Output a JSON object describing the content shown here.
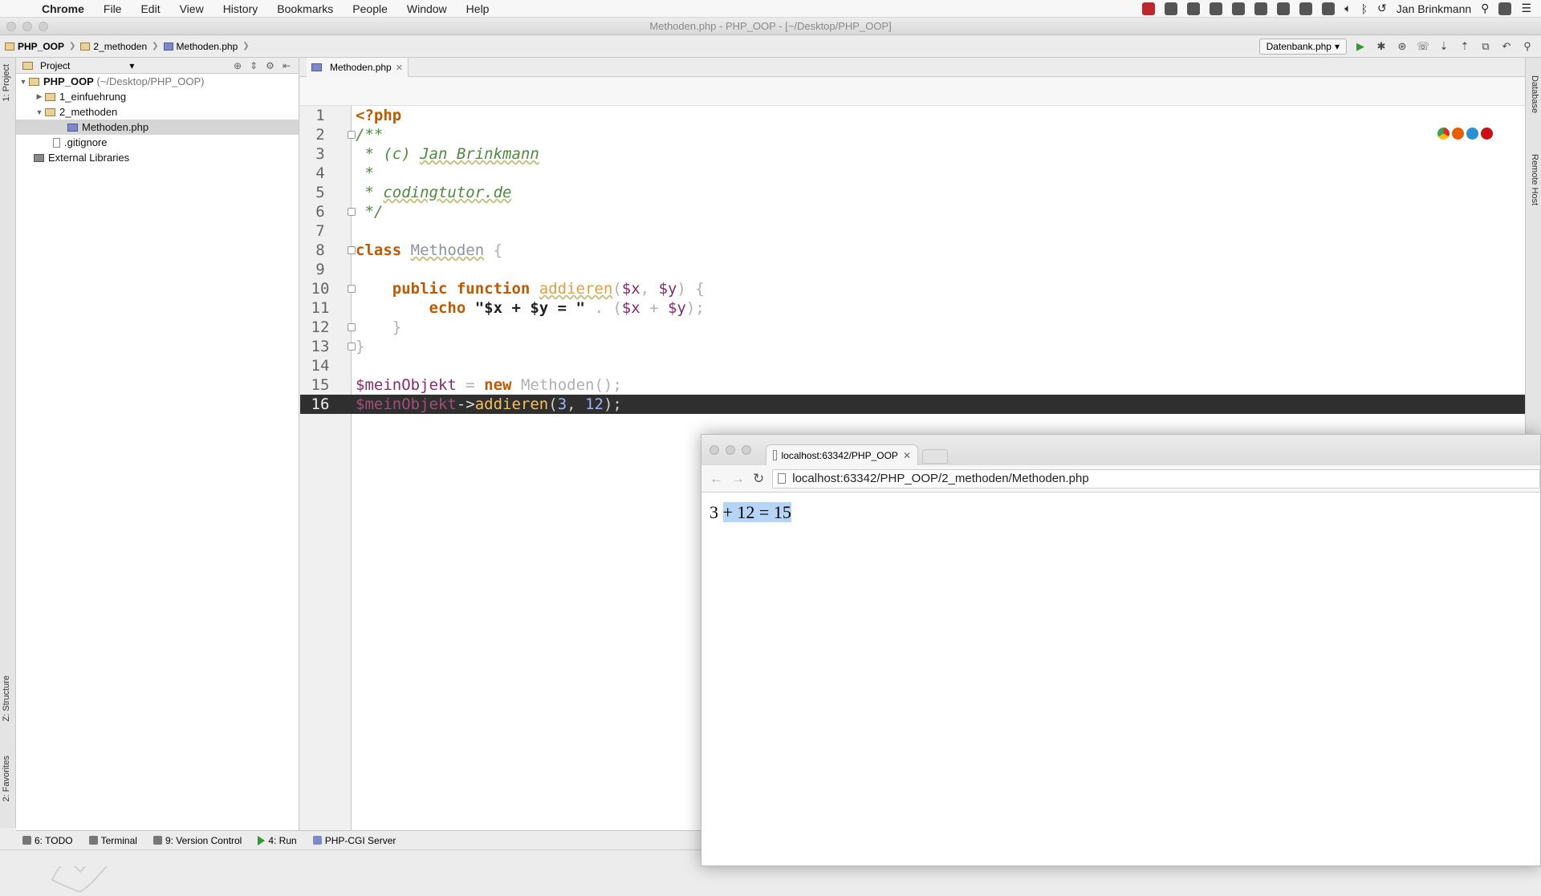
{
  "menubar": {
    "app": "Chrome",
    "items": [
      "File",
      "Edit",
      "View",
      "History",
      "Bookmarks",
      "People",
      "Window",
      "Help"
    ],
    "user": "Jan Brinkmann"
  },
  "window": {
    "title": "Methoden.php - PHP_OOP - [~/Desktop/PHP_OOP]"
  },
  "navbar": {
    "breadcrumbs": [
      "PHP_OOP",
      "2_methoden",
      "Methoden.php"
    ],
    "run_config": "Datenbank.php"
  },
  "left_tabs": {
    "project": "1: Project",
    "structure": "Z: Structure",
    "favorites": "2: Favorites"
  },
  "right_tabs": {
    "database": "Database",
    "remote_host": "Remote Host"
  },
  "project": {
    "header": "Project",
    "root_name": "PHP_OOP",
    "root_path": "(~/Desktop/PHP_OOP)",
    "folder1": "1_einfuehrung",
    "folder2": "2_methoden",
    "file_selected": "Methoden.php",
    "gitignore": ".gitignore",
    "libraries": "External Libraries"
  },
  "editor": {
    "tab": "Methoden.php",
    "lines": [
      "1",
      "2",
      "3",
      "4",
      "5",
      "6",
      "7",
      "8",
      "9",
      "10",
      "11",
      "12",
      "13",
      "14",
      "15",
      "16"
    ],
    "code": {
      "l1": "<?php",
      "l2": "/**",
      "l3a": " * (c) ",
      "l3b": "Jan Brinkmann",
      "l4": " *",
      "l5a": " * ",
      "l5b": "codingtutor.de",
      "l6": " */",
      "l8a": "class ",
      "l8b": "Methoden",
      "l8c": " {",
      "l10a": "    public function ",
      "l10b": "addieren",
      "l10c": "(",
      "l10d": "$x",
      "l10e": ", ",
      "l10f": "$y",
      "l10g": ") {",
      "l11a": "        echo ",
      "l11b": "\"$x + $y = \"",
      "l11c": " . (",
      "l11d": "$x",
      "l11e": " + ",
      "l11f": "$y",
      "l11g": ");",
      "l12": "    }",
      "l13": "}",
      "l15a": "$meinObjekt",
      "l15b": " = ",
      "l15c": "new ",
      "l15d": "Methoden",
      "l15e": "();",
      "l16a": "$meinObjekt",
      "l16b": "->",
      "l16c": "addieren",
      "l16d": "(",
      "l16e": "3",
      "l16f": ", ",
      "l16g": "12",
      "l16h": ");"
    }
  },
  "bottom": {
    "todo": "6: TODO",
    "terminal": "Terminal",
    "vcs": "9: Version Control",
    "run": "4: Run",
    "server": "PHP-CGI Server"
  },
  "browser": {
    "tab_title": "localhost:63342/PHP_OOP",
    "url": "localhost:63342/PHP_OOP/2_methoden/Methoden.php",
    "output_plain": "3 ",
    "output_selected": "+ 12 = 15"
  }
}
